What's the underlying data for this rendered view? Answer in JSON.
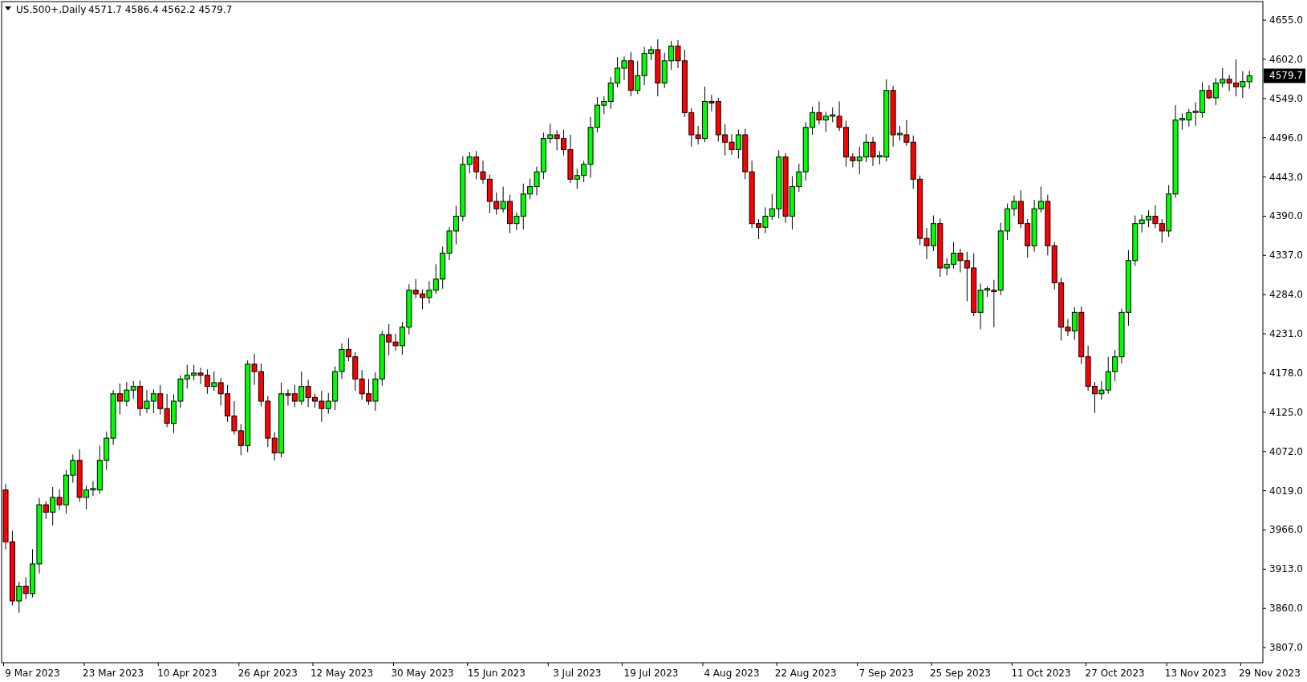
{
  "header": {
    "title": "US.500+,Daily",
    "ohlc_readout": "4571.7 4586.4 4562.2 4579.7"
  },
  "current_price": "4579.7",
  "chart_data": {
    "type": "candlestick",
    "ylim": [
      3786.5,
      4680
    ],
    "categories": [
      null,
      null,
      null,
      null,
      "9 Mar 2023",
      null,
      null,
      null,
      null,
      null,
      null,
      null,
      null,
      null,
      null,
      null,
      "23 Mar 2023",
      null,
      null,
      null,
      null,
      null,
      null,
      null,
      null,
      null,
      null,
      "10 Apr 2023",
      null,
      null,
      null,
      null,
      null,
      null,
      null,
      null,
      null,
      null,
      null,
      "26 Apr 2023",
      null,
      null,
      null,
      null,
      null,
      null,
      null,
      null,
      null,
      null,
      "12 May 2023",
      null,
      null,
      null,
      null,
      null,
      null,
      null,
      null,
      null,
      null,
      null,
      "30 May 2023",
      null,
      null,
      null,
      null,
      null,
      null,
      null,
      null,
      null,
      null,
      "15 Jun 2023",
      null,
      null,
      null,
      null,
      null,
      null,
      null,
      null,
      null,
      null,
      null,
      "3 Jul 2023",
      null,
      null,
      null,
      null,
      null,
      null,
      null,
      null,
      null,
      null,
      "19 Jul 2023",
      null,
      null,
      null,
      null,
      null,
      null,
      null,
      null,
      null,
      null,
      null,
      "4 Aug 2023",
      null,
      null,
      null,
      null,
      null,
      null,
      null,
      null,
      null,
      null,
      "22 Aug 2023",
      null,
      null,
      null,
      null,
      null,
      null,
      null,
      null,
      null,
      null,
      null,
      "7 Sep 2023",
      null,
      null,
      null,
      null,
      null,
      null,
      null,
      null,
      null,
      null,
      "25 Sep 2023",
      null,
      null,
      null,
      null,
      null,
      null,
      null,
      null,
      null,
      null,
      null,
      "11 Oct 2023",
      null,
      null,
      null,
      null,
      null,
      null,
      null,
      null,
      null,
      null,
      "27 Oct 2023",
      null,
      null,
      null,
      null,
      null,
      null,
      null,
      null,
      null,
      null,
      null,
      "13 Nov 2023",
      null,
      null,
      null,
      null,
      null,
      null,
      null,
      null,
      null,
      null,
      "29 Nov 2023"
    ],
    "yticks": [
      {
        "value": 4655,
        "label": "4655.0"
      },
      {
        "value": 4602,
        "label": "4602.0"
      },
      {
        "value": 4549,
        "label": "4549.0"
      },
      {
        "value": 4496,
        "label": "4496.0"
      },
      {
        "value": 4443,
        "label": "4443.0"
      },
      {
        "value": 4390,
        "label": "4390.0"
      },
      {
        "value": 4337,
        "label": "4337.0"
      },
      {
        "value": 4284,
        "label": "4284.0"
      },
      {
        "value": 4231,
        "label": "4231.0"
      },
      {
        "value": 4178,
        "label": "4178.0"
      },
      {
        "value": 4125,
        "label": "4125.0"
      },
      {
        "value": 4072,
        "label": "4072.0"
      },
      {
        "value": 4019,
        "label": "4019.0"
      },
      {
        "value": 3966,
        "label": "3966.0"
      },
      {
        "value": 3913,
        "label": "3913.0"
      },
      {
        "value": 3860,
        "label": "3860.0"
      },
      {
        "value": 3807,
        "label": "3807.0"
      }
    ],
    "ohlc": [
      [
        4020,
        4028,
        3940,
        3950
      ],
      [
        3950,
        3965,
        3864,
        3870
      ],
      [
        3870,
        3896,
        3854,
        3890
      ],
      [
        3890,
        3902,
        3872,
        3880
      ],
      [
        3880,
        3940,
        3875,
        3920
      ],
      [
        3920,
        4009,
        3907,
        4000
      ],
      [
        4000,
        4005,
        3981,
        3990
      ],
      [
        3990,
        4024,
        3972,
        4010
      ],
      [
        4010,
        4021,
        3993,
        4000
      ],
      [
        4000,
        4047,
        3988,
        4040
      ],
      [
        4040,
        4068,
        4030,
        4060
      ],
      [
        4060,
        4075,
        4004,
        4010
      ],
      [
        4010,
        4026,
        3994,
        4020
      ],
      [
        4020,
        4032,
        4012,
        4022
      ],
      [
        4020,
        4080,
        4015,
        4060
      ],
      [
        4060,
        4099,
        4047,
        4090
      ],
      [
        4090,
        4155,
        4081,
        4150
      ],
      [
        4150,
        4164,
        4122,
        4140
      ],
      [
        4140,
        4166,
        4133,
        4155
      ],
      [
        4155,
        4167,
        4143,
        4160
      ],
      [
        4160,
        4168,
        4120,
        4130
      ],
      [
        4130,
        4155,
        4124,
        4140
      ],
      [
        4140,
        4156,
        4124,
        4150
      ],
      [
        4150,
        4162,
        4122,
        4130
      ],
      [
        4130,
        4150,
        4105,
        4110
      ],
      [
        4110,
        4149,
        4097,
        4140
      ],
      [
        4140,
        4175,
        4131,
        4170
      ],
      [
        4170,
        4189,
        4157,
        4175
      ],
      [
        4175,
        4189,
        4168,
        4178
      ],
      [
        4178,
        4185,
        4163,
        4175
      ],
      [
        4175,
        4183,
        4150,
        4160
      ],
      [
        4160,
        4180,
        4154,
        4165
      ],
      [
        4165,
        4171,
        4134,
        4150
      ],
      [
        4150,
        4162,
        4112,
        4120
      ],
      [
        4120,
        4140,
        4095,
        4100
      ],
      [
        4100,
        4109,
        4067,
        4080
      ],
      [
        4080,
        4195,
        4071,
        4190
      ],
      [
        4190,
        4204,
        4162,
        4180
      ],
      [
        4180,
        4191,
        4133,
        4140
      ],
      [
        4140,
        4147,
        4078,
        4090
      ],
      [
        4090,
        4098,
        4060,
        4070
      ],
      [
        4070,
        4165,
        4064,
        4150
      ],
      [
        4150,
        4156,
        4134,
        4148
      ],
      [
        4150,
        4162,
        4132,
        4140
      ],
      [
        4140,
        4180,
        4135,
        4160
      ],
      [
        4160,
        4169,
        4132,
        4145
      ],
      [
        4145,
        4150,
        4131,
        4140
      ],
      [
        4140,
        4154,
        4112,
        4130
      ],
      [
        4130,
        4151,
        4123,
        4140
      ],
      [
        4140,
        4187,
        4128,
        4180
      ],
      [
        4180,
        4218,
        4170,
        4210
      ],
      [
        4210,
        4225,
        4194,
        4200
      ],
      [
        4200,
        4206,
        4154,
        4170
      ],
      [
        4170,
        4182,
        4142,
        4150
      ],
      [
        4150,
        4170,
        4135,
        4140
      ],
      [
        4140,
        4179,
        4127,
        4170
      ],
      [
        4170,
        4235,
        4161,
        4230
      ],
      [
        4230,
        4244,
        4202,
        4220
      ],
      [
        4220,
        4231,
        4208,
        4215
      ],
      [
        4215,
        4247,
        4203,
        4240
      ],
      [
        4240,
        4298,
        4230,
        4290
      ],
      [
        4290,
        4305,
        4279,
        4285
      ],
      [
        4285,
        4291,
        4264,
        4280
      ],
      [
        4280,
        4302,
        4272,
        4290
      ],
      [
        4290,
        4325,
        4285,
        4305
      ],
      [
        4305,
        4349,
        4292,
        4340
      ],
      [
        4340,
        4375,
        4331,
        4370
      ],
      [
        4370,
        4404,
        4352,
        4390
      ],
      [
        4390,
        4471,
        4383,
        4460
      ],
      [
        4460,
        4477,
        4448,
        4470
      ],
      [
        4470,
        4478,
        4440,
        4450
      ],
      [
        4450,
        4465,
        4434,
        4440
      ],
      [
        4440,
        4446,
        4394,
        4410
      ],
      [
        4410,
        4422,
        4392,
        4400
      ],
      [
        4400,
        4430,
        4395,
        4410
      ],
      [
        4410,
        4419,
        4367,
        4380
      ],
      [
        4380,
        4395,
        4371,
        4390
      ],
      [
        4390,
        4434,
        4372,
        4420
      ],
      [
        4420,
        4441,
        4413,
        4430
      ],
      [
        4430,
        4457,
        4418,
        4450
      ],
      [
        4450,
        4503,
        4440,
        4495
      ],
      [
        4495,
        4515,
        4489,
        4500
      ],
      [
        4500,
        4506,
        4479,
        4495
      ],
      [
        4495,
        4507,
        4472,
        4480
      ],
      [
        4480,
        4500,
        4435,
        4440
      ],
      [
        4440,
        4454,
        4427,
        4445
      ],
      [
        4445,
        4465,
        4436,
        4460
      ],
      [
        4460,
        4524,
        4442,
        4510
      ],
      [
        4510,
        4551,
        4503,
        4540
      ],
      [
        4540,
        4552,
        4528,
        4545
      ],
      [
        4545,
        4578,
        4535,
        4570
      ],
      [
        4570,
        4605,
        4564,
        4590
      ],
      [
        4590,
        4606,
        4574,
        4600
      ],
      [
        4600,
        4612,
        4552,
        4560
      ],
      [
        4560,
        4600,
        4555,
        4580
      ],
      [
        4580,
        4619,
        4567,
        4610
      ],
      [
        4610,
        4620,
        4601,
        4615
      ],
      [
        4615,
        4629,
        4552,
        4570
      ],
      [
        4570,
        4611,
        4563,
        4600
      ],
      [
        4600,
        4627,
        4588,
        4620
      ],
      [
        4620,
        4628,
        4590,
        4600
      ],
      [
        4600,
        4615,
        4524,
        4530
      ],
      [
        4530,
        4536,
        4484,
        4500
      ],
      [
        4500,
        4512,
        4487,
        4495
      ],
      [
        4495,
        4565,
        4490,
        4545
      ],
      [
        4545,
        4554,
        4532,
        4543
      ],
      [
        4545,
        4550,
        4491,
        4500
      ],
      [
        4500,
        4514,
        4472,
        4490
      ],
      [
        4490,
        4501,
        4473,
        4480
      ],
      [
        4480,
        4507,
        4468,
        4500
      ],
      [
        4500,
        4508,
        4440,
        4450
      ],
      [
        4450,
        4465,
        4374,
        4380
      ],
      [
        4380,
        4386,
        4359,
        4375
      ],
      [
        4375,
        4402,
        4367,
        4390
      ],
      [
        4390,
        4420,
        4385,
        4400
      ],
      [
        4400,
        4479,
        4387,
        4470
      ],
      [
        4470,
        4475,
        4381,
        4390
      ],
      [
        4390,
        4444,
        4372,
        4430
      ],
      [
        4430,
        4461,
        4423,
        4450
      ],
      [
        4450,
        4517,
        4438,
        4510
      ],
      [
        4510,
        4538,
        4500,
        4530
      ],
      [
        4530,
        4545,
        4514,
        4520
      ],
      [
        4520,
        4531,
        4504,
        4525
      ],
      [
        4525,
        4537,
        4517,
        4527
      ],
      [
        4525,
        4545,
        4505,
        4510
      ],
      [
        4510,
        4519,
        4457,
        4470
      ],
      [
        4470,
        4475,
        4456,
        4465
      ],
      [
        4465,
        4484,
        4447,
        4470
      ],
      [
        4470,
        4501,
        4463,
        4490
      ],
      [
        4490,
        4497,
        4458,
        4470
      ],
      [
        4470,
        4478,
        4460,
        4472
      ],
      [
        4470,
        4575,
        4464,
        4560
      ],
      [
        4560,
        4566,
        4484,
        4500
      ],
      [
        4500,
        4512,
        4492,
        4502
      ],
      [
        4500,
        4520,
        4485,
        4490
      ],
      [
        4490,
        4499,
        4427,
        4440
      ],
      [
        4440,
        4445,
        4351,
        4360
      ],
      [
        4360,
        4374,
        4332,
        4350
      ],
      [
        4350,
        4391,
        4343,
        4380
      ],
      [
        4380,
        4387,
        4308,
        4320
      ],
      [
        4320,
        4333,
        4310,
        4325
      ],
      [
        4325,
        4355,
        4319,
        4340
      ],
      [
        4340,
        4346,
        4314,
        4330
      ],
      [
        4330,
        4342,
        4275,
        4320
      ],
      [
        4320,
        4340,
        4255,
        4260
      ],
      [
        4260,
        4299,
        4237,
        4290
      ],
      [
        4290,
        4295,
        4281,
        4292
      ],
      [
        4290,
        4304,
        4240,
        4288
      ],
      [
        4290,
        4381,
        4283,
        4370
      ],
      [
        4370,
        4407,
        4358,
        4400
      ],
      [
        4400,
        4418,
        4390,
        4410
      ],
      [
        4410,
        4425,
        4374,
        4380
      ],
      [
        4380,
        4386,
        4334,
        4350
      ],
      [
        4350,
        4412,
        4342,
        4400
      ],
      [
        4400,
        4430,
        4395,
        4410
      ],
      [
        4410,
        4419,
        4337,
        4350
      ],
      [
        4350,
        4355,
        4291,
        4300
      ],
      [
        4300,
        4307,
        4222,
        4240
      ],
      [
        4240,
        4251,
        4228,
        4235
      ],
      [
        4235,
        4267,
        4223,
        4260
      ],
      [
        4260,
        4268,
        4190,
        4200
      ],
      [
        4200,
        4215,
        4154,
        4160
      ],
      [
        4160,
        4166,
        4124,
        4150
      ],
      [
        4150,
        4167,
        4142,
        4155
      ],
      [
        4155,
        4200,
        4150,
        4180
      ],
      [
        4180,
        4209,
        4167,
        4200
      ],
      [
        4200,
        4265,
        4191,
        4260
      ],
      [
        4260,
        4344,
        4242,
        4330
      ],
      [
        4330,
        4391,
        4323,
        4380
      ],
      [
        4380,
        4392,
        4368,
        4385
      ],
      [
        4385,
        4398,
        4375,
        4390
      ],
      [
        4390,
        4405,
        4374,
        4380
      ],
      [
        4380,
        4386,
        4354,
        4370
      ],
      [
        4370,
        4432,
        4362,
        4420
      ],
      [
        4420,
        4540,
        4415,
        4520
      ],
      [
        4520,
        4529,
        4507,
        4522
      ],
      [
        4520,
        4535,
        4511,
        4530
      ],
      [
        4530,
        4544,
        4512,
        4532
      ],
      [
        4530,
        4571,
        4523,
        4560
      ],
      [
        4560,
        4567,
        4548,
        4550
      ],
      [
        4550,
        4577,
        4540,
        4570
      ],
      [
        4570,
        4590,
        4564,
        4575
      ],
      [
        4575,
        4581,
        4559,
        4570
      ],
      [
        4570,
        4602,
        4552,
        4565
      ],
      [
        4565,
        4586,
        4550,
        4572
      ],
      [
        4571.7,
        4586.4,
        4562.2,
        4579.7
      ],
      null,
      null,
      null
    ]
  }
}
